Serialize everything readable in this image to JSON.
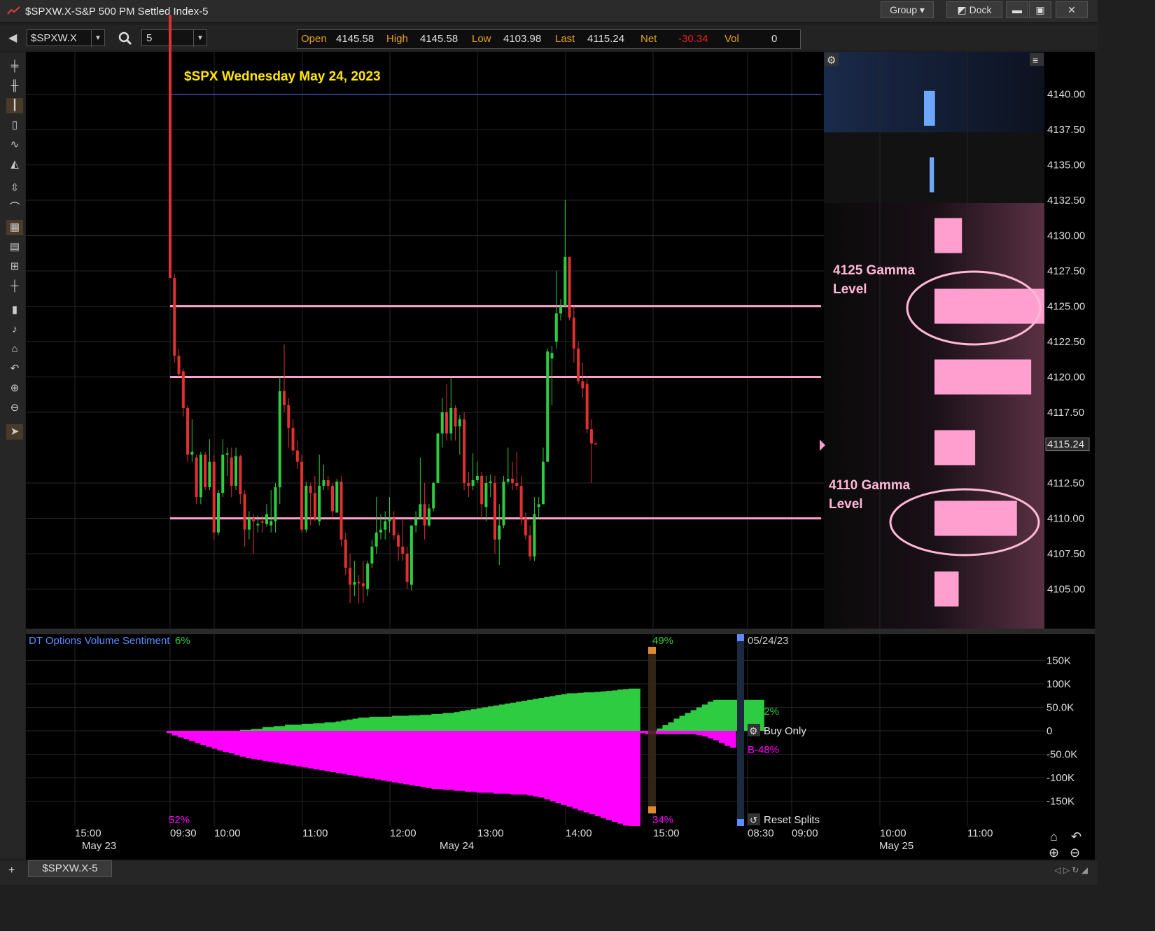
{
  "window": {
    "title": "$SPXW.X-S&P 500 PM Settled Index-5",
    "group_label": "Group",
    "dock_label": "Dock"
  },
  "toolbar": {
    "symbol": "$SPXW.X",
    "interval": "5",
    "quote": {
      "open_label": "Open",
      "open": "4145.58",
      "high_label": "High",
      "high": "4145.58",
      "low_label": "Low",
      "low": "4103.98",
      "last_label": "Last",
      "last": "4115.24",
      "net_label": "Net",
      "net": "-30.34",
      "vol_label": "Vol",
      "vol": "0"
    }
  },
  "chart_data": [
    {
      "type": "candlestick",
      "title": "$SPX Wednesday May 24, 2023",
      "y_ticks": [
        "4140.00",
        "4137.50",
        "4135.00",
        "4132.50",
        "4130.00",
        "4127.50",
        "4125.00",
        "4122.50",
        "4120.00",
        "4117.50",
        "4115.24",
        "4112.50",
        "4110.00",
        "4107.50",
        "4105.00"
      ],
      "last_price": "4115.24",
      "ylim": [
        4102.2,
        4143.0
      ],
      "horizontal_lines": [
        4125,
        4120,
        4110
      ],
      "open_line": 4140,
      "annotations": [
        {
          "text_lines": [
            "4125 Gamma",
            "Level"
          ]
        },
        {
          "text_lines": [
            "4110 Gamma",
            "Level"
          ]
        }
      ],
      "volume_profile": [
        {
          "price": 4139,
          "size": 0.1,
          "color": "#6ea8fe"
        },
        {
          "price": 4134.3,
          "size": 0.04,
          "color": "#6ea8fe"
        },
        {
          "price": 4130,
          "size": 0.25,
          "color": "#ff9fd0"
        },
        {
          "price": 4125,
          "size": 1.0,
          "color": "#ff9fd0"
        },
        {
          "price": 4120,
          "size": 0.88,
          "color": "#ff9fd0"
        },
        {
          "price": 4115,
          "size": 0.37,
          "color": "#ff9fd0"
        },
        {
          "price": 4110,
          "size": 0.75,
          "color": "#ff9fd0"
        },
        {
          "price": 4105,
          "size": 0.22,
          "color": "#ff9fd0"
        }
      ],
      "candles": [
        [
          4145.6,
          4145.6,
          4127.0,
          4127.0
        ],
        [
          4127.0,
          4127.3,
          4121.0,
          4121.5
        ],
        [
          4121.5,
          4122.0,
          4120.0,
          4120.2
        ],
        [
          4120.4,
          4120.6,
          4117.2,
          4117.8
        ],
        [
          4117.8,
          4118.0,
          4114.0,
          4114.5
        ],
        [
          4114.5,
          4117.0,
          4114.0,
          4114.7
        ],
        [
          4114.3,
          4114.5,
          4111.0,
          4111.5
        ],
        [
          4111.5,
          4114.7,
          4111.0,
          4114.5
        ],
        [
          4114.5,
          4114.7,
          4112.0,
          4112.2
        ],
        [
          4112.2,
          4115.6,
          4112.0,
          4114.0
        ],
        [
          4114.0,
          4114.5,
          4108.5,
          4109.0
        ],
        [
          4109.0,
          4112.0,
          4108.8,
          4111.8
        ],
        [
          4111.8,
          4115.6,
          4111.5,
          4114.5
        ],
        [
          4114.5,
          4115.0,
          4113.0,
          4114.6
        ],
        [
          4114.3,
          4115.0,
          4111.5,
          4112.3
        ],
        [
          4112.3,
          4115.0,
          4112.0,
          4114.4
        ],
        [
          4114.4,
          4114.5,
          4111.0,
          4111.7
        ],
        [
          4111.7,
          4112.0,
          4108.0,
          4109.2
        ],
        [
          4109.2,
          4110.5,
          4108.5,
          4110.0
        ],
        [
          4110.0,
          4110.3,
          4107.5,
          4109.8
        ],
        [
          4109.5,
          4110.2,
          4109.0,
          4109.6
        ],
        [
          4109.8,
          4110.2,
          4109.0,
          4109.7
        ],
        [
          4109.6,
          4111.0,
          4109.4,
          4110.3
        ],
        [
          4109.5,
          4112.0,
          4109.0,
          4109.8
        ],
        [
          4109.8,
          4112.5,
          4109.0,
          4112.2
        ],
        [
          4112.2,
          4120.0,
          4111.0,
          4119.0
        ],
        [
          4119.0,
          4122.3,
          4117.5,
          4118.0
        ],
        [
          4118.0,
          4118.5,
          4115.0,
          4116.4
        ],
        [
          4116.4,
          4117.0,
          4114.5,
          4114.8
        ],
        [
          4114.8,
          4115.5,
          4113.5,
          4114.0
        ],
        [
          4114.0,
          4114.5,
          4109.0,
          4109.2
        ],
        [
          4109.2,
          4112.6,
          4109.0,
          4112.3
        ],
        [
          4112.3,
          4112.5,
          4109.5,
          4111.8
        ],
        [
          4111.8,
          4113.0,
          4109.8,
          4110.0
        ],
        [
          4109.8,
          4114.5,
          4109.5,
          4112.3
        ],
        [
          4112.3,
          4113.8,
          4112.0,
          4112.7
        ],
        [
          4112.7,
          4113.0,
          4112.0,
          4112.3
        ],
        [
          4112.3,
          4112.5,
          4110.0,
          4110.5
        ],
        [
          4110.4,
          4112.8,
          4110.5,
          4112.6
        ],
        [
          4112.6,
          4113.0,
          4108.0,
          4108.5
        ],
        [
          4108.5,
          4109.0,
          4106.0,
          4106.5
        ],
        [
          4106.5,
          4107.5,
          4104.0,
          4105.3
        ],
        [
          4105.3,
          4107.0,
          4104.5,
          4105.5
        ],
        [
          4105.5,
          4106.0,
          4104.0,
          4105.4
        ],
        [
          4105.4,
          4107.0,
          4104.0,
          4105.2
        ],
        [
          4105.0,
          4107.0,
          4104.5,
          4106.8
        ],
        [
          4106.8,
          4108.5,
          4106.5,
          4108.0
        ],
        [
          4108.0,
          4111.5,
          4107.5,
          4109.0
        ],
        [
          4109.0,
          4110.3,
          4108.5,
          4109.2
        ],
        [
          4109.2,
          4110.5,
          4108.5,
          4109.8
        ],
        [
          4109.8,
          4111.5,
          4109.0,
          4110.0
        ],
        [
          4110.0,
          4110.5,
          4108.5,
          4108.8
        ],
        [
          4108.8,
          4109.0,
          4107.0,
          4108.0
        ],
        [
          4108.0,
          4110.0,
          4107.0,
          4107.5
        ],
        [
          4107.5,
          4108.0,
          4105.0,
          4105.5
        ],
        [
          4105.3,
          4109.5,
          4104.9,
          4109.5
        ],
        [
          4109.5,
          4110.5,
          4109.0,
          4110.0
        ],
        [
          4110.0,
          4114.3,
          4110.0,
          4111.0
        ],
        [
          4111.0,
          4112.5,
          4108.5,
          4109.5
        ],
        [
          4109.5,
          4111.0,
          4109.4,
          4110.7
        ],
        [
          4110.7,
          4112.6,
          4110.5,
          4112.5
        ],
        [
          4112.5,
          4116.0,
          4112.5,
          4116.0
        ],
        [
          4116.0,
          4118.5,
          4115.0,
          4117.5
        ],
        [
          4117.5,
          4119.5,
          4115.5,
          4116.0
        ],
        [
          4116.0,
          4120.0,
          4115.5,
          4117.8
        ],
        [
          4117.8,
          4118.0,
          4115.5,
          4116.5
        ],
        [
          4116.5,
          4117.3,
          4114.5,
          4117.0
        ],
        [
          4117.0,
          4117.5,
          4112.0,
          4112.5
        ],
        [
          4112.5,
          4113.3,
          4111.5,
          4112.3
        ],
        [
          4112.3,
          4114.6,
          4112.0,
          4112.7
        ],
        [
          4112.7,
          4114.0,
          4112.5,
          4113.0
        ],
        [
          4113.0,
          4113.3,
          4110.0,
          4111.0
        ],
        [
          4110.8,
          4113.0,
          4109.8,
          4112.5
        ],
        [
          4112.5,
          4113.1,
          4111.5,
          4112.6
        ],
        [
          4112.5,
          4113.0,
          4107.5,
          4108.5
        ],
        [
          4108.5,
          4111.0,
          4106.7,
          4109.5
        ],
        [
          4109.5,
          4113.0,
          4109.3,
          4112.6
        ],
        [
          4112.6,
          4115.0,
          4112.4,
          4112.8
        ],
        [
          4112.8,
          4114.0,
          4112.0,
          4112.5
        ],
        [
          4112.5,
          4114.7,
          4112.0,
          4112.3
        ],
        [
          4112.3,
          4113.0,
          4109.5,
          4110.0
        ],
        [
          4110.0,
          4110.4,
          4108.5,
          4108.8
        ],
        [
          4108.8,
          4109.5,
          4107.0,
          4107.3
        ],
        [
          4107.3,
          4111.5,
          4107.0,
          4110.3
        ],
        [
          4110.8,
          4111.5,
          4110.0,
          4111.0
        ],
        [
          4111.0,
          4115.0,
          4111.0,
          4114.0
        ],
        [
          4114.0,
          4122.0,
          4114.0,
          4121.8
        ],
        [
          4121.3,
          4122.2,
          4118.0,
          4121.7
        ],
        [
          4122.5,
          4127.5,
          4122.0,
          4124.5
        ],
        [
          4124.5,
          4125.5,
          4124.0,
          4125.0
        ],
        [
          4125.0,
          4132.5,
          4125.0,
          4128.5
        ],
        [
          4128.5,
          4128.5,
          4124.0,
          4124.2
        ],
        [
          4124.2,
          4125.0,
          4121.0,
          4122.0
        ],
        [
          4122.0,
          4122.5,
          4119.5,
          4119.7
        ],
        [
          4119.7,
          4121.0,
          4118.5,
          4119.2
        ],
        [
          4119.5,
          4120.0,
          4116.0,
          4116.3
        ],
        [
          4116.3,
          4117.0,
          4112.5,
          4115.3
        ],
        [
          4115.3,
          4115.4,
          4115.2,
          4115.24
        ]
      ]
    },
    {
      "type": "area",
      "title": "DT Options Volume Sentiment",
      "y_ticks": [
        "150K",
        "100K",
        "50.0K",
        "0",
        "-50.0K",
        "-100K",
        "-150K"
      ],
      "ylim": [
        -200,
        200
      ],
      "labels": {
        "top_left_pct": "6%",
        "bottom_left_pct": "52%",
        "top_mid_pct": "49%",
        "bottom_mid_pct": "34%",
        "date": "05/24/23",
        "buy_pct": "B-32%",
        "sell_pct": "B-48%",
        "buy_only": "Buy Only",
        "reset_splits": "Reset Splits"
      },
      "buy_series": [
        0,
        0,
        0,
        0,
        0,
        0,
        0,
        0,
        0,
        0,
        0,
        0,
        0,
        2,
        2,
        4,
        4,
        8,
        8,
        10,
        10,
        13,
        13,
        13,
        15,
        15,
        16,
        16,
        18,
        18,
        20,
        22,
        24,
        26,
        28,
        28,
        30,
        30,
        30,
        30,
        32,
        32,
        32,
        33,
        33,
        34,
        34,
        36,
        36,
        38,
        38,
        40,
        42,
        44,
        46,
        48,
        50,
        52,
        54,
        56,
        58,
        60,
        62,
        64,
        66,
        68,
        70,
        72,
        74,
        76,
        78,
        80,
        80,
        81,
        82,
        82,
        83,
        84,
        85,
        86,
        88,
        89,
        90,
        90,
        0,
        0,
        0,
        5,
        12,
        18,
        26,
        32,
        38,
        44,
        50,
        56,
        62,
        66,
        66,
        66,
        66,
        66,
        66,
        66,
        66,
        66
      ],
      "sell_series": [
        -5,
        -10,
        -14,
        -18,
        -22,
        -26,
        -30,
        -34,
        -38,
        -42,
        -45,
        -48,
        -52,
        -55,
        -58,
        -60,
        -62,
        -64,
        -66,
        -68,
        -70,
        -72,
        -74,
        -76,
        -78,
        -80,
        -82,
        -84,
        -86,
        -88,
        -90,
        -92,
        -94,
        -96,
        -98,
        -100,
        -102,
        -104,
        -106,
        -108,
        -110,
        -112,
        -114,
        -116,
        -118,
        -120,
        -122,
        -124,
        -124,
        -126,
        -126,
        -128,
        -128,
        -130,
        -130,
        -132,
        -132,
        -132,
        -134,
        -134,
        -134,
        -136,
        -136,
        -136,
        -138,
        -140,
        -142,
        -146,
        -150,
        -154,
        -158,
        -162,
        -166,
        -170,
        -174,
        -178,
        -182,
        -186,
        -190,
        -194,
        -198,
        -202,
        -206,
        -214,
        -5,
        -7,
        -7,
        -7,
        -7,
        -7,
        -7,
        -7,
        -7,
        -7,
        -9,
        -12,
        -16,
        -20,
        -26,
        -32,
        -36
      ]
    }
  ],
  "time_axis": {
    "times": [
      "15:00",
      "09:30",
      "10:00",
      "11:00",
      "12:00",
      "13:00",
      "14:00",
      "15:00",
      "08:30",
      "09:00",
      "10:00",
      "11:00"
    ],
    "dates": [
      "May 23",
      "May 24",
      "May 25"
    ]
  },
  "bottom": {
    "tab_label": "$SPXW.X-5"
  }
}
